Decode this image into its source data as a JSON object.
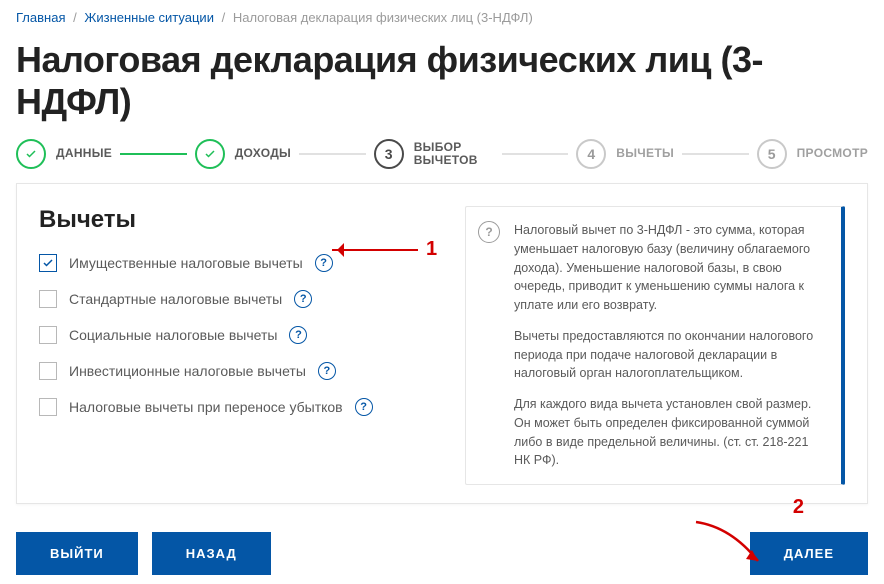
{
  "breadcrumb": {
    "home": "Главная",
    "life": "Жизненные ситуации",
    "current": "Налоговая декларация физических лиц (3-НДФЛ)"
  },
  "title": "Налоговая декларация физических лиц (3-НДФЛ)",
  "steps": [
    {
      "num": "",
      "label": "ДАННЫЕ",
      "state": "done"
    },
    {
      "num": "",
      "label": "ДОХОДЫ",
      "state": "done"
    },
    {
      "num": "3",
      "label": "ВЫБОР ВЫЧЕТОВ",
      "state": "current"
    },
    {
      "num": "4",
      "label": "ВЫЧЕТЫ",
      "state": "future"
    },
    {
      "num": "5",
      "label": "ПРОСМОТР",
      "state": "future"
    }
  ],
  "section_title": "Вычеты",
  "options": [
    {
      "label": "Имущественные налоговые вычеты",
      "checked": true
    },
    {
      "label": "Стандартные налоговые вычеты",
      "checked": false
    },
    {
      "label": "Социальные налоговые вычеты",
      "checked": false
    },
    {
      "label": "Инвестиционные налоговые вычеты",
      "checked": false
    },
    {
      "label": "Налоговые вычеты при переносе убытков",
      "checked": false
    }
  ],
  "info": {
    "p1": "Налоговый вычет по 3-НДФЛ - это сумма, которая уменьшает налоговую базу (величину облагаемого дохода). Уменьшение налоговой базы, в свою очередь, приводит к уменьшению суммы налога к уплате или его возврату.",
    "p2": "Вычеты предоставляются по окончании налогового периода при подаче налоговой декларации в налоговый орган налогоплательщиком.",
    "p3": "Для каждого вида вычета установлен свой размер. Он может быть определен фиксированной суммой либо в виде предельной величины. (ст. ст. 218-221 НК РФ)."
  },
  "buttons": {
    "exit": "ВЫЙТИ",
    "back": "НАЗАД",
    "next": "ДАЛЕЕ"
  },
  "annotations": {
    "n1": "1",
    "n2": "2"
  }
}
